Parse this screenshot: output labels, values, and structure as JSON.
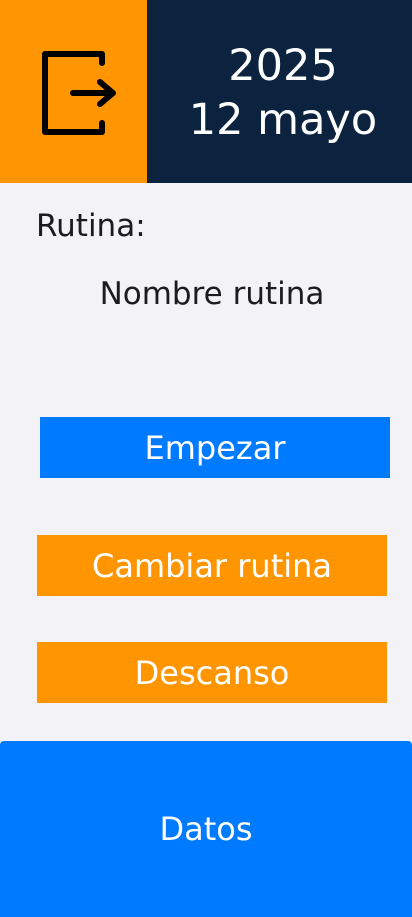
{
  "colors": {
    "orange": "#FF9500",
    "blue": "#007AFF",
    "navy": "#0C2340",
    "background": "#F2F2F7"
  },
  "header": {
    "exit_icon": "logout-icon",
    "year": "2025",
    "date": "12 mayo"
  },
  "routine": {
    "label": "Rutina:",
    "name": "Nombre rutina"
  },
  "buttons": {
    "start": "Empezar",
    "change": "Cambiar rutina",
    "rest": "Descanso",
    "data": "Datos"
  }
}
